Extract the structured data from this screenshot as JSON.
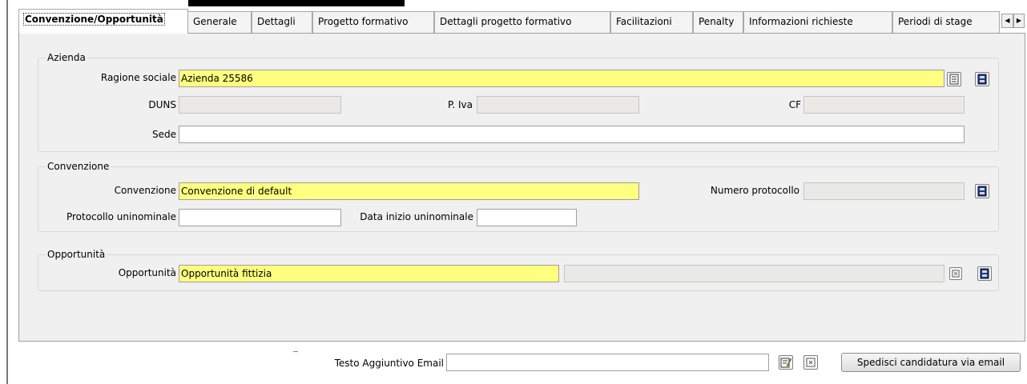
{
  "tabs": [
    {
      "label": "Convenzione/Opportunità",
      "active": true
    },
    {
      "label": "Generale",
      "active": false
    },
    {
      "label": "Dettagli",
      "active": false
    },
    {
      "label": "Progetto formativo",
      "active": false
    },
    {
      "label": "Dettagli progetto formativo",
      "active": false
    },
    {
      "label": "Facilitazioni",
      "active": false
    },
    {
      "label": "Penalty",
      "active": false
    },
    {
      "label": "Informazioni richieste",
      "active": false
    },
    {
      "label": "Periodi di stage",
      "active": false
    }
  ],
  "azienda": {
    "title": "Azienda",
    "ragione_sociale_label": "Ragione sociale",
    "ragione_sociale_value": "Azienda 25586",
    "duns_label": "DUNS",
    "duns_value": "",
    "piva_label": "P. Iva",
    "piva_value": "",
    "cf_label": "CF",
    "cf_value": "",
    "sede_label": "Sede",
    "sede_value": ""
  },
  "convenzione": {
    "title": "Convenzione",
    "convenzione_label": "Convenzione",
    "convenzione_value": "Convenzione di default",
    "numero_protocollo_label": "Numero protocollo",
    "numero_protocollo_value": "",
    "protocollo_uninominale_label": "Protocollo uninominale",
    "protocollo_uninominale_value": "",
    "data_inizio_label": "Data inizio uninominale",
    "data_inizio_value": ""
  },
  "opportunita": {
    "title": "Opportunità",
    "label": "Opportunità",
    "value": "Opportunità fittizia",
    "extra_value": ""
  },
  "footer": {
    "testo_label": "Testo Aggiuntivo Email",
    "testo_value": "",
    "send_button": "Spedisci candidatura via email"
  },
  "colors": {
    "required_field": "#ffff80",
    "readonly_field": "#ebe9e5",
    "panel": "#f0f0f0"
  },
  "icons": [
    "list-icon",
    "save-icon",
    "lookup-icon",
    "edit-icon",
    "clear-icon",
    "scroll-left-icon",
    "scroll-right-icon"
  ]
}
